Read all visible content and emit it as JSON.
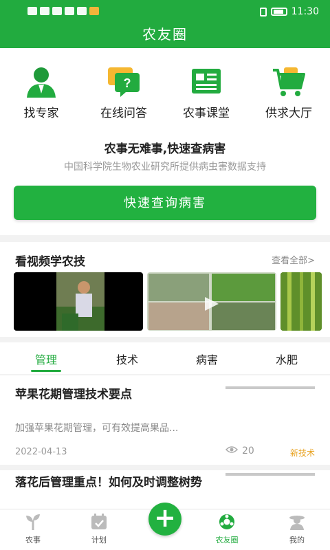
{
  "status": {
    "time": "11:30"
  },
  "app": {
    "title": "农友圈"
  },
  "quick_actions": [
    {
      "label": "找专家",
      "icon": "expert-icon"
    },
    {
      "label": "在线问答",
      "icon": "qa-icon"
    },
    {
      "label": "农事课堂",
      "icon": "classroom-icon"
    },
    {
      "label": "供求大厅",
      "icon": "cart-icon"
    }
  ],
  "promo": {
    "headline": "农事无难事,快速查病害",
    "subline": "中国科学院生物农业研究所提供病虫害数据支持",
    "button": "快速查询病害"
  },
  "video": {
    "title": "看视频学农技",
    "more": "查看全部>"
  },
  "tabs": [
    "管理",
    "技术",
    "病害",
    "水肥"
  ],
  "articles": [
    {
      "title": "苹果花期管理技术要点",
      "summary": "加强苹果花期管理，可有效提高果品...",
      "date": "2022-04-13",
      "views": "20",
      "tag": "新技术"
    },
    {
      "title": "落花后管理重点！如何及时调整树势"
    }
  ],
  "bottom_nav": [
    {
      "label": "农事",
      "icon": "sprout-icon"
    },
    {
      "label": "计划",
      "icon": "calendar-icon"
    },
    {
      "label": "+",
      "icon": "add-icon"
    },
    {
      "label": "农友圈",
      "icon": "circle-icon"
    },
    {
      "label": "我的",
      "icon": "profile-icon"
    }
  ],
  "colors": {
    "primary": "#22ab3f",
    "tag": "#e8a21f"
  }
}
